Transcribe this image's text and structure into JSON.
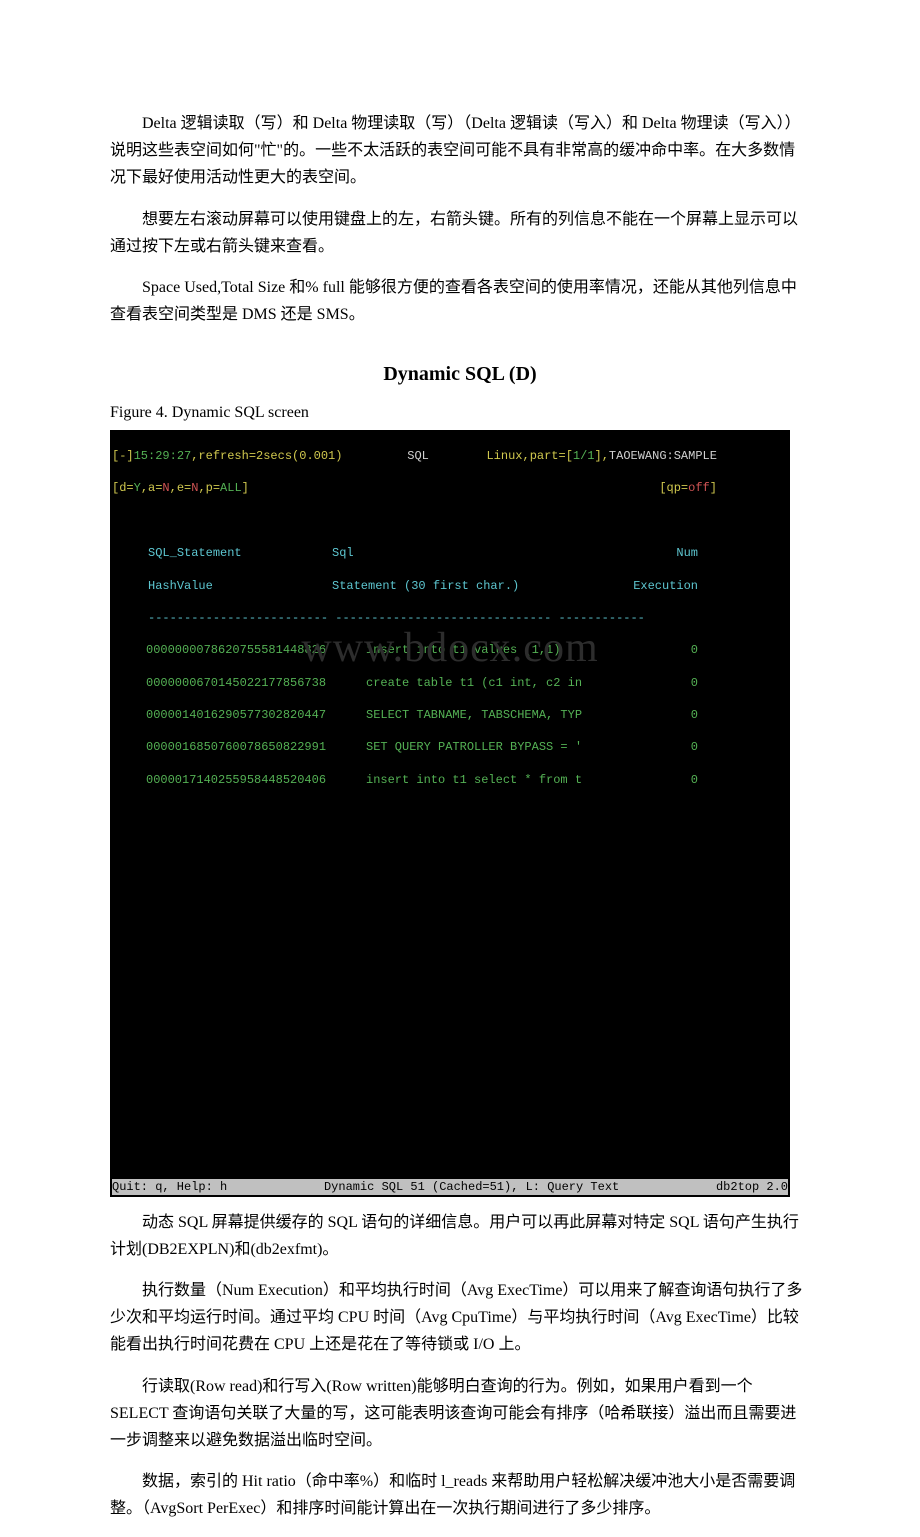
{
  "paragraphs": {
    "p1": "Delta 逻辑读取（写）和 Delta 物理读取（写）（Delta 逻辑读（写入）和 Delta 物理读（写入））说明这些表空间如何\"忙\"的。一些不太活跃的表空间可能不具有非常高的缓冲命中率。在大多数情况下最好使用活动性更大的表空间。",
    "p2": "想要左右滚动屏幕可以使用键盘上的左，右箭头键。所有的列信息不能在一个屏幕上显示可以通过按下左或右箭头键来查看。",
    "p3": "Space Used,Total Size 和% full 能够很方便的查看各表空间的使用率情况，还能从其他列信息中查看表空间类型是 DMS 还是 SMS。",
    "p4": "动态 SQL 屏幕提供缓存的 SQL 语句的详细信息。用户可以再此屏幕对特定 SQL 语句产生执行计划(DB2EXPLN)和(db2exfmt)。",
    "p5": "执行数量（Num Execution）和平均执行时间（Avg ExecTime）可以用来了解查询语句执行了多少次和平均运行时间。通过平均 CPU 时间（Avg CpuTime）与平均执行时间（Avg ExecTime）比较能看出执行时间花费在 CPU 上还是花在了等待锁或 I/O 上。",
    "p6": "行读取(Row read)和行写入(Row written)能够明白查询的行为。例如，如果用户看到一个 SELECT 查询语句关联了大量的写，这可能表明该查询可能会有排序（哈希联接）溢出而且需要进一步调整来以避免数据溢出临时空间。",
    "p7": "数据，索引的 Hit ratio（命中率%）和临时 l_reads 来帮助用户轻松解决缓冲池大小是否需要调整。（AvgSort PerExec）和排序时间能计算出在一次执行期间进行了多少排序。"
  },
  "section_title": "Dynamic SQL (D)",
  "figure_caption": "Figure 4. Dynamic SQL screen",
  "terminal": {
    "topline": {
      "left_prefix": "[-]",
      "time": "15:29:27",
      "refresh": ",refresh=2secs(0.001)",
      "center": "SQL",
      "right_prefix": "Linux,part=[",
      "part": "1/1",
      "right_mid": "],",
      "host": "TAOEWANG:SAMPLE"
    },
    "flags": {
      "d_label": "[d=",
      "d_val": "Y",
      "a_label": ",a=",
      "a_val": "N",
      "e_label": ",e=",
      "e_val": "N",
      "p_label": ",p=",
      "p_val": "ALL",
      "end": "]",
      "qp_label": "[qp=",
      "qp_val": "off",
      "qp_end": "]"
    },
    "header1_col1": "SQL_Statement",
    "header1_col2": "Sql",
    "header1_col3": "Num",
    "header2_col1": "HashValue",
    "header2_col2": "Statement (30 first char.)",
    "header2_col3": "Execution",
    "dashes": "     ------------------------- ------------------------------ ------------",
    "rows": [
      {
        "hash": "0000000078620755581448826",
        "stmt": "insert into t1 values (1,1)",
        "num": "0"
      },
      {
        "hash": "0000000670145022177856738",
        "stmt": "create table t1 (c1 int, c2 in",
        "num": "0"
      },
      {
        "hash": "0000014016290577302820447",
        "stmt": "SELECT TABNAME, TABSCHEMA, TYP",
        "num": "0"
      },
      {
        "hash": "0000016850760078650822991",
        "stmt": "SET QUERY PATROLLER BYPASS = '",
        "num": "0"
      },
      {
        "hash": "0000017140255958448520406",
        "stmt": "insert into t1 select * from t",
        "num": "0"
      }
    ],
    "watermark": "www.bdocx.com",
    "bottom_left": "Quit: q, Help: h",
    "bottom_mid": "Dynamic SQL 51 (Cached=51), L: Query Text",
    "bottom_right": "db2top 2.0"
  }
}
